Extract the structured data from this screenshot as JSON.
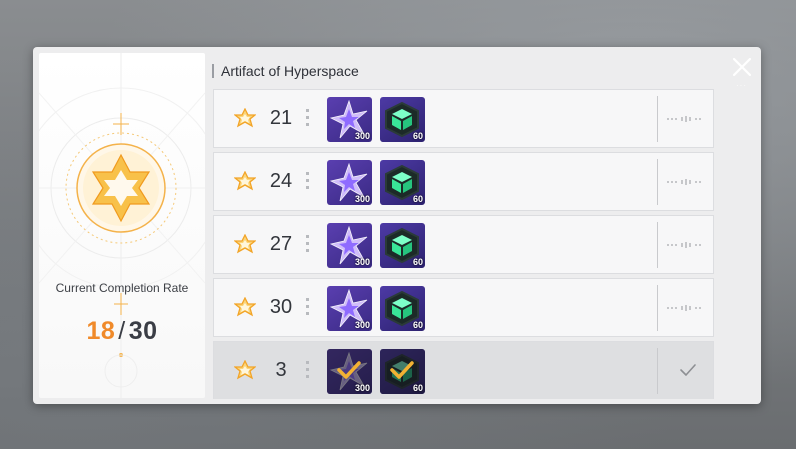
{
  "panel": {
    "section_title": "Artifact of Hyperspace",
    "completion_label": "Current Completion Rate",
    "completion_current": "18",
    "completion_separator": "/",
    "completion_total": "30"
  },
  "rows": [
    {
      "stars": "21",
      "items": [
        {
          "icon": "purple-crystal-icon",
          "qty": "300"
        },
        {
          "icon": "green-cube-icon",
          "qty": "60"
        }
      ],
      "claimed": false
    },
    {
      "stars": "24",
      "items": [
        {
          "icon": "purple-crystal-icon",
          "qty": "300"
        },
        {
          "icon": "green-cube-icon",
          "qty": "60"
        }
      ],
      "claimed": false
    },
    {
      "stars": "27",
      "items": [
        {
          "icon": "purple-crystal-icon",
          "qty": "300"
        },
        {
          "icon": "green-cube-icon",
          "qty": "60"
        }
      ],
      "claimed": false
    },
    {
      "stars": "30",
      "items": [
        {
          "icon": "purple-crystal-icon",
          "qty": "300"
        },
        {
          "icon": "green-cube-icon",
          "qty": "60"
        }
      ],
      "claimed": false
    },
    {
      "stars": "3",
      "items": [
        {
          "icon": "purple-crystal-icon",
          "qty": "300"
        },
        {
          "icon": "green-cube-icon",
          "qty": "60"
        }
      ],
      "claimed": true
    }
  ],
  "colors": {
    "accent_orange": "#f08a2a",
    "star_gold": "#f2b233",
    "item_purple": "#5a3fb0",
    "cube_green": "#4fffb0"
  },
  "close_icon": "close-icon"
}
